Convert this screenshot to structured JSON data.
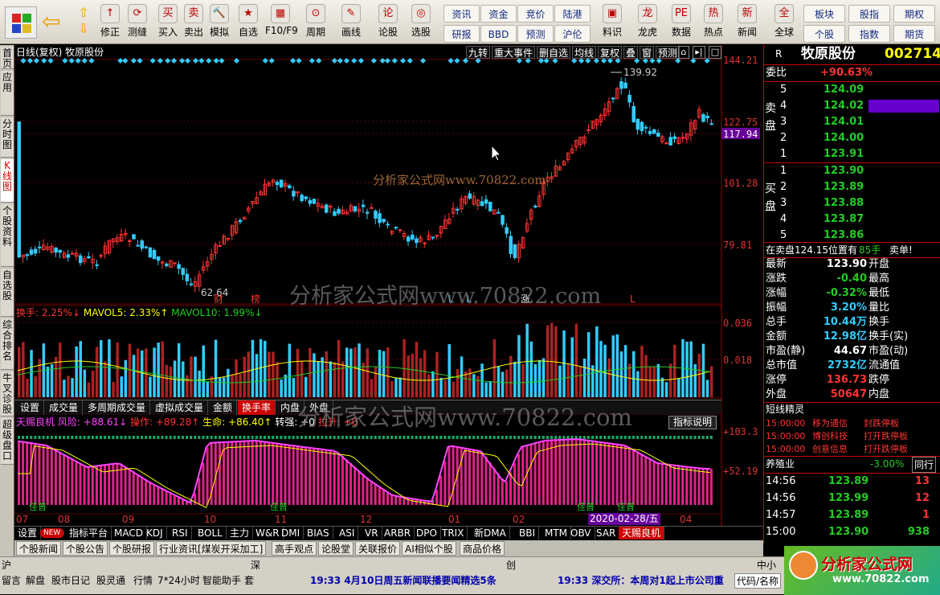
{
  "toolbar": {
    "row1": [
      [
        "↑",
        "修正"
      ],
      [
        "⟳",
        "测缝"
      ],
      [
        "买",
        "买入"
      ],
      [
        "卖",
        "卖出"
      ],
      [
        "🔨",
        "模拟"
      ],
      [
        "★",
        "自选"
      ],
      [
        "▦",
        "F10/F9"
      ],
      [
        "⊙",
        "周期"
      ],
      [
        "✎",
        "画线"
      ],
      [
        "论",
        "论股"
      ],
      [
        "◎",
        "选股"
      ]
    ],
    "grid": [
      "资讯",
      "资金",
      "竞价",
      "陆港",
      "研报",
      "BBD",
      "预测",
      "沪伦"
    ],
    "row1b": [
      [
        "▣",
        "料识"
      ],
      [
        "龙",
        "龙虎"
      ],
      [
        "PE",
        "数据"
      ],
      [
        "热",
        "热点"
      ],
      [
        "新",
        "新闻"
      ],
      [
        "全",
        "全球"
      ]
    ],
    "grid2": [
      "板块",
      "股指",
      "期权",
      "个股",
      "指数",
      "期货"
    ]
  },
  "lefttabs": [
    "首页",
    "应用",
    "分时图",
    "K线图",
    "个股资料",
    "自选股",
    "综合排名",
    "牛叉诊股",
    "超级盘口"
  ],
  "chart": {
    "title": "日线(复权) 牧原股份",
    "buttons": [
      "九转",
      "重大事件",
      "删自选",
      "均线",
      "复权",
      "叠",
      "窗",
      "预测"
    ],
    "price_ticks": [
      "144.21",
      "122.75",
      "117.94",
      "101.28",
      "79.81"
    ],
    "high_label": "139.92",
    "low_label": "62.64",
    "events": [
      "财",
      "榜",
      "L",
      "L",
      "涨",
      "L"
    ],
    "vol_header": {
      "a": "换手: 2.25%↓",
      "b": "MAVOL5: 2.33%↑",
      "c": "MAVOL10: 1.99%↓"
    },
    "vol_ticks": [
      "0.036",
      "0.018"
    ],
    "subtabs": [
      "设置",
      "成交量",
      "多周期成交量",
      "虚拟成交量",
      "金额",
      "换手率",
      "内盘",
      "外盘"
    ],
    "ind_header": {
      "a": "天赐良机",
      "b": "风险: +88.61↓",
      "c": "操作: +89.28↑",
      "d": "生命: +86.40↑",
      "e": "转强: +0",
      "f": "拉升: +0"
    },
    "ind_button": "指标说明",
    "ind_ticks": [
      "+103.3",
      "+52.19"
    ],
    "months": [
      "07",
      "08",
      "09",
      "10",
      "11",
      "12",
      "01",
      "02",
      "03",
      "04"
    ],
    "date_label": "2020-02-28/五",
    "green_labels": [
      "佳普",
      "佳普",
      "佳普",
      "佳普",
      "佳普"
    ]
  },
  "watermarks": [
    "分析家公式网www.70822.com",
    "分析家公式网www.70822.com",
    "分析家公式网www.70822.com"
  ],
  "quote": {
    "r": "R",
    "name": "牧原股份",
    "code": "002714",
    "weibi_label": "委比",
    "weibi": "+90.63%",
    "sell": [
      [
        "5",
        "124.09"
      ],
      [
        "4",
        "124.02"
      ],
      [
        "3",
        "124.01"
      ],
      [
        "2",
        "124.00"
      ],
      [
        "1",
        "123.91"
      ]
    ],
    "buy": [
      [
        "1",
        "123.90"
      ],
      [
        "2",
        "123.89"
      ],
      [
        "3",
        "123.88"
      ],
      [
        "4",
        "123.87"
      ],
      [
        "5",
        "123.86"
      ]
    ],
    "sell_label": "卖盘",
    "buy_label": "买盘",
    "status": "在卖盘124.15位置有",
    "status_n": "85手",
    "status_t": "卖单!",
    "stats": [
      [
        "最新",
        "123.90",
        "开盘"
      ],
      [
        "涨跌",
        "-0.40",
        "最高"
      ],
      [
        "涨幅",
        "-0.32%",
        "最低"
      ],
      [
        "振幅",
        "3.20%",
        "量比"
      ],
      [
        "总手",
        "10.44万",
        "换手"
      ],
      [
        "金额",
        "12.98亿",
        "换手(实)"
      ],
      [
        "市盈(静)",
        "44.67",
        "市盈(动)"
      ],
      [
        "总市值",
        "2732亿",
        "流通值"
      ],
      [
        "涨停",
        "136.73",
        "跌停"
      ],
      [
        "外盘",
        "50647",
        "内盘"
      ]
    ],
    "sprite_title": "短线精灵",
    "sprite": [
      [
        "15:00:00",
        "移为通信",
        "封跌停板"
      ],
      [
        "15:00:00",
        "博创科技",
        "打开跌停板"
      ],
      [
        "15:00:00",
        "创意信息",
        "打开跌停板"
      ]
    ],
    "industry": "养殖业",
    "industry_pct": "-3.00%",
    "industry_btn": "同行",
    "ticks": [
      [
        "14:56",
        "123.89",
        "13"
      ],
      [
        "14:56",
        "123.99",
        "12"
      ],
      [
        "14:57",
        "123.89",
        "1"
      ],
      [
        "15:00",
        "123.90",
        "938"
      ]
    ]
  },
  "indtabs": [
    "设置",
    "NEW",
    "指标平台",
    "MACD",
    "KDJ",
    "RSI",
    "BOLL",
    "主力",
    "W&R",
    "DMI",
    "BIAS",
    "ASI",
    "VR",
    "ARBR",
    "DPO",
    "TRIX",
    "新DMA",
    "BBI",
    "MTM",
    "OBV",
    "SAR",
    "天赐良机"
  ],
  "newstabs": [
    "个股新闻",
    "个股公告",
    "个股研报",
    "行业资讯[煤炭开采加工]",
    "高手观点",
    "论股堂",
    "关联报价",
    "AI相似个股",
    "商品价格"
  ],
  "status": {
    "row1": [
      "沪",
      "深",
      "创",
      "中小"
    ],
    "row2": [
      "留言",
      "解盘",
      "股市日记",
      "股灵通",
      "行情",
      "7*24小时",
      "智能助手",
      "套"
    ],
    "news1": "19:33 4月10日周五新闻联播要闻精选5条",
    "news2": "19:33 深交所：本周对1起上市公司重",
    "tab": "代码/名称",
    "logo": "分析家公式网",
    "logo2": "www.70822.com"
  }
}
